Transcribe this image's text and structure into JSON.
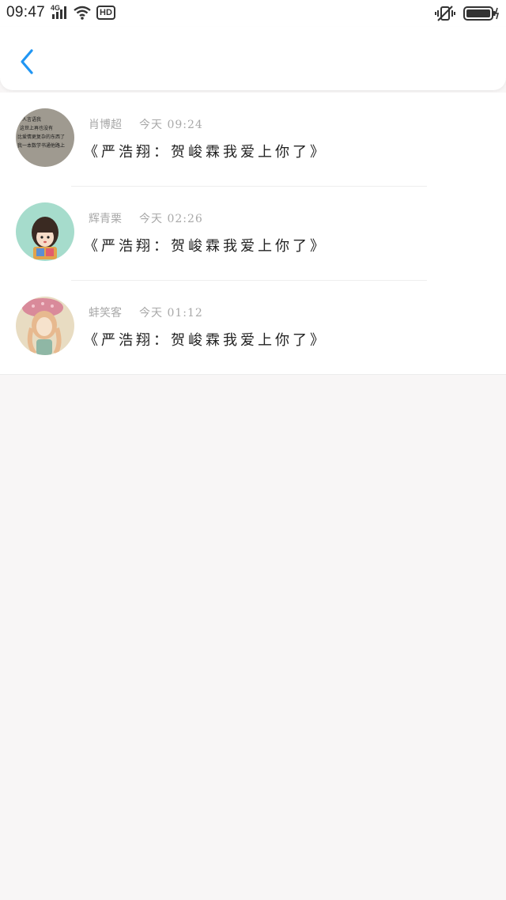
{
  "status_bar": {
    "time": "09:47",
    "network": "4G",
    "hd": "HD"
  },
  "header": {
    "back_icon": "chevron-left-icon"
  },
  "comments": [
    {
      "name": "肖博超",
      "time": "今天 09:24",
      "text": "《严浩翔：贺峻霖我爱上你了》",
      "avatar_text": [
        "人言语我",
        "这世上再也没有",
        "比爱情更复杂的东西了",
        "我一本数学书通他路上"
      ]
    },
    {
      "name": "辉青栗",
      "time": "今天 02:26",
      "text": "《严浩翔：贺峻霖我爱上你了》"
    },
    {
      "name": "蚌笑客",
      "time": "今天 01:12",
      "text": "《严浩翔：贺峻霖我爱上你了》"
    }
  ]
}
